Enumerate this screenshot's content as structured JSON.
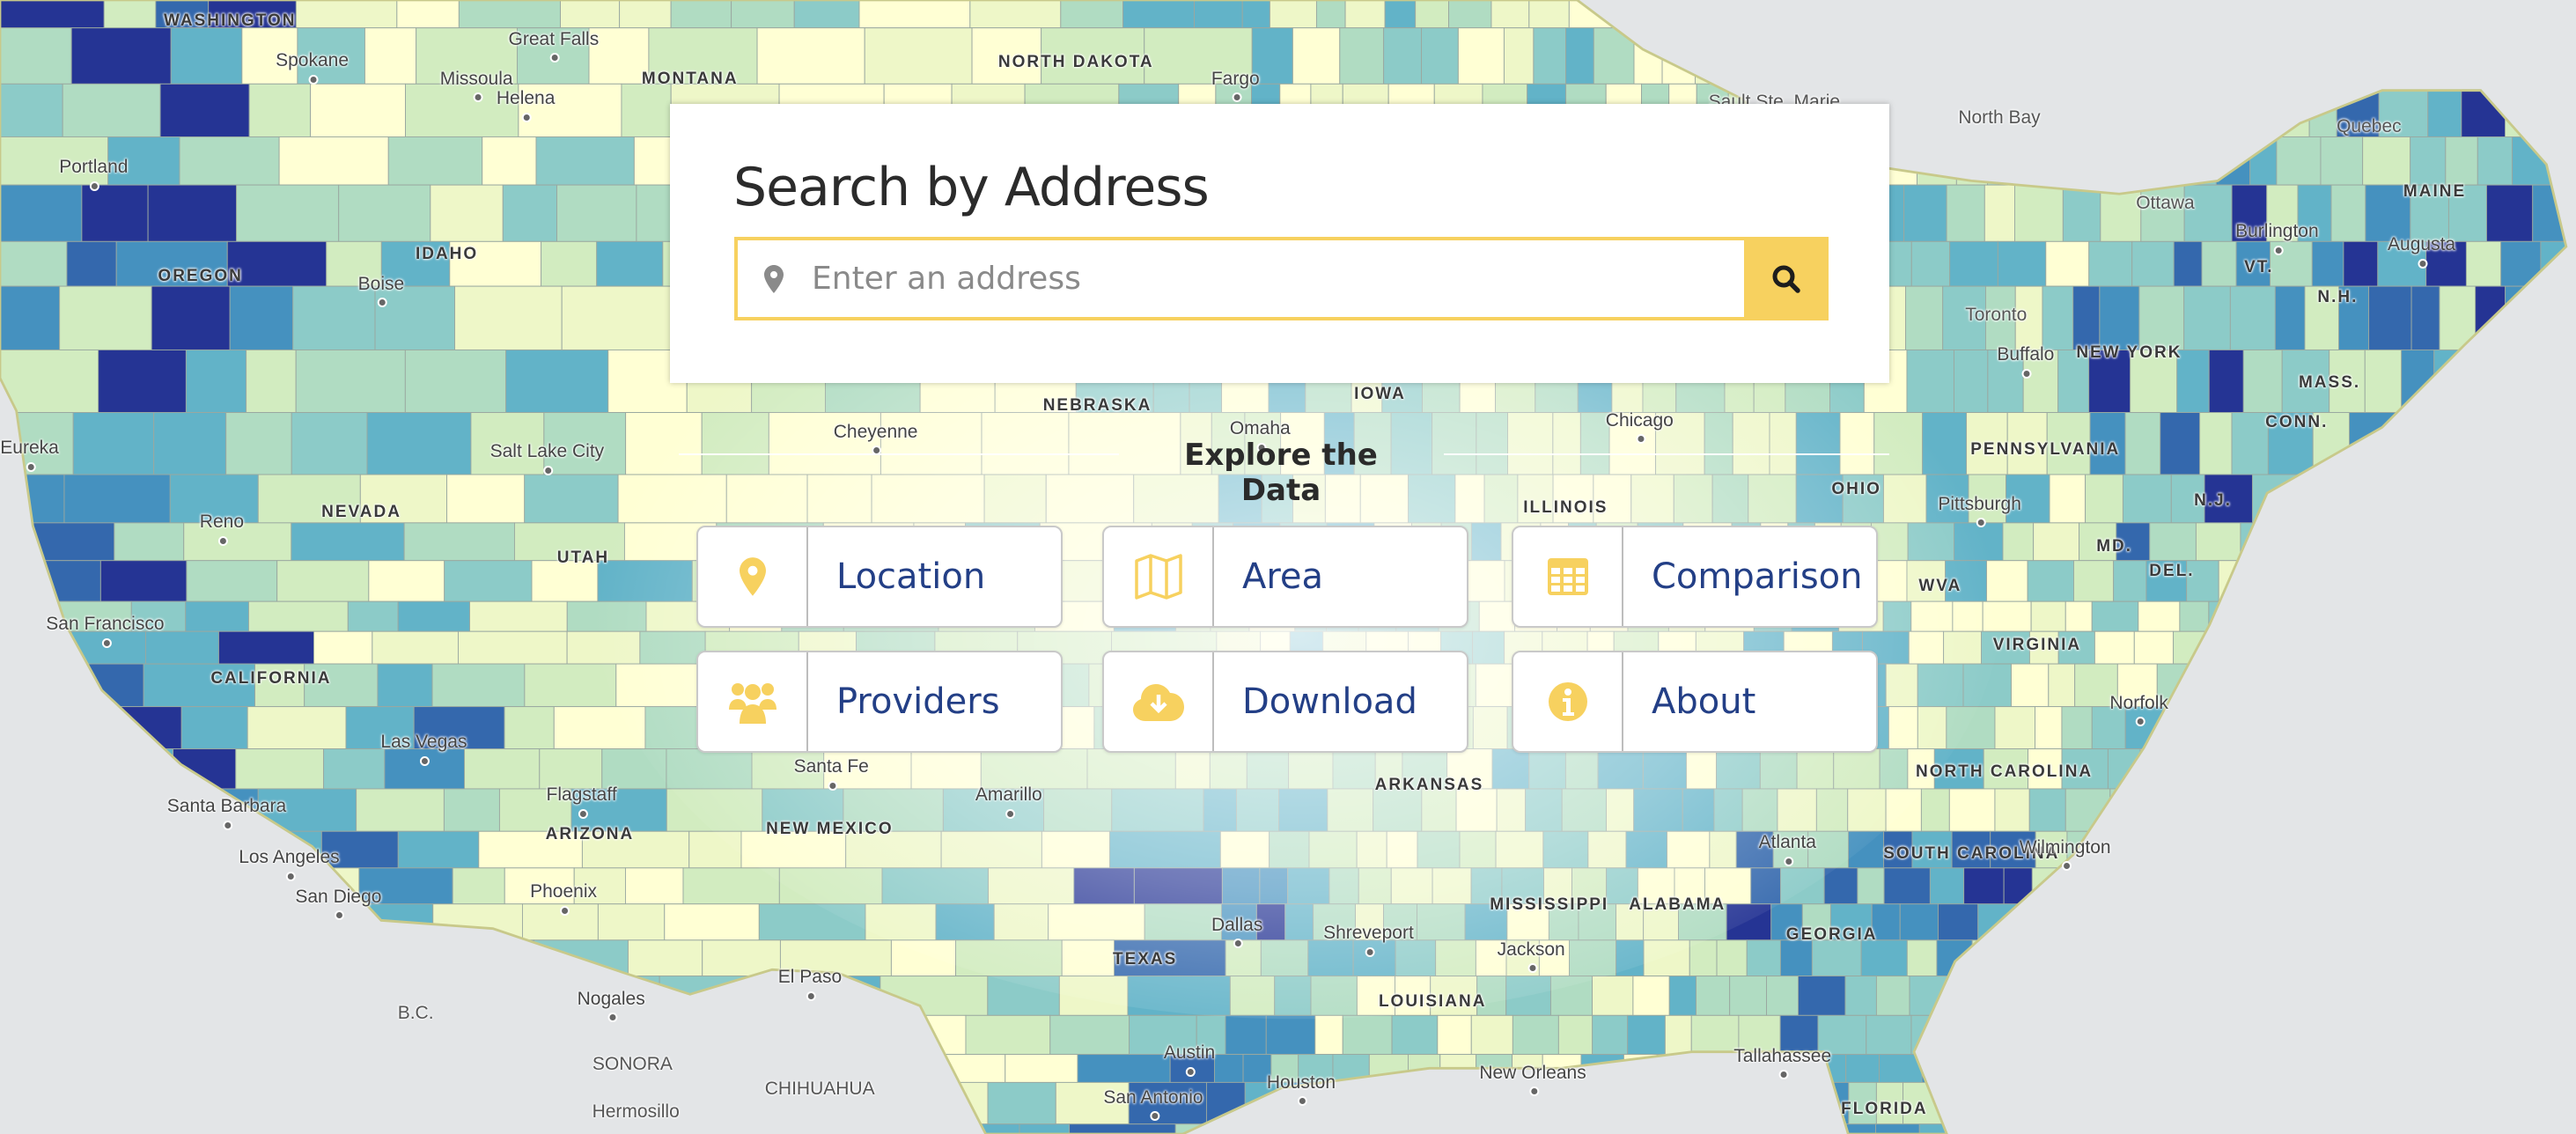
{
  "search": {
    "title": "Search by Address",
    "placeholder": "Enter an address",
    "value": "",
    "pin_icon": "map-marker-icon",
    "button_icon": "search-icon"
  },
  "explore": {
    "heading": "Explore the Data",
    "buttons": [
      {
        "label": "Location",
        "icon": "map-marker-icon"
      },
      {
        "label": "Area",
        "icon": "map-icon"
      },
      {
        "label": "Comparison",
        "icon": "table-icon"
      },
      {
        "label": "Providers",
        "icon": "users-icon"
      },
      {
        "label": "Download",
        "icon": "cloud-download-icon"
      },
      {
        "label": "About",
        "icon": "info-circle-icon"
      }
    ]
  },
  "colors": {
    "accent": "#f7d15f",
    "button_text": "#233f86",
    "choropleth": [
      "#ffffd4",
      "#eef7c8",
      "#d2ecc0",
      "#b0dcc2",
      "#8ccbc8",
      "#62b3c8",
      "#4591bf",
      "#3468ad",
      "#253494"
    ]
  },
  "map": {
    "states": [
      "WASHINGTON",
      "MONTANA",
      "NORTH DAKOTA",
      "OREGON",
      "IDAHO",
      "NEVADA",
      "UTAH",
      "CALIFORNIA",
      "ARIZONA",
      "NEW MEXICO",
      "TEXAS",
      "NEBRASKA",
      "IOWA",
      "ILLINOIS",
      "OHIO",
      "ARKANSAS",
      "LOUISIANA",
      "MISSISSIPPI",
      "ALABAMA",
      "GEORGIA",
      "FLORIDA",
      "SOUTH CAROLINA",
      "NORTH CAROLINA",
      "VIRGINIA",
      "WVA",
      "MD.",
      "DEL.",
      "N.J.",
      "PENNSYLVANIA",
      "NEW YORK",
      "VT.",
      "N.H.",
      "MASS.",
      "CONN.",
      "MAINE"
    ],
    "cities": [
      "Spokane",
      "Great Falls",
      "Missoula",
      "Helena",
      "Fargo",
      "Portland",
      "Boise",
      "Eureka",
      "Reno",
      "Salt Lake City",
      "San Francisco",
      "Las Vegas",
      "Santa Barbara",
      "Flagstaff",
      "Phoenix",
      "Los Angeles",
      "San Diego",
      "Nogales",
      "El Paso",
      "Santa Fe",
      "Amarillo",
      "Dallas",
      "Austin",
      "San Antonio",
      "Houston",
      "Shreveport",
      "New Orleans",
      "Jackson",
      "Atlanta",
      "Tallahassee",
      "Wilmington",
      "Norfolk",
      "Pittsburgh",
      "Chicago",
      "Omaha",
      "Cheyenne",
      "Buffalo",
      "Burlington",
      "Augusta"
    ],
    "foreign": [
      "B.C.",
      "SONORA",
      "Hermosillo",
      "CHIHUAHUA",
      "Toronto",
      "Ottawa",
      "North Bay",
      "Quebec",
      "Sault Ste. Marie"
    ]
  }
}
